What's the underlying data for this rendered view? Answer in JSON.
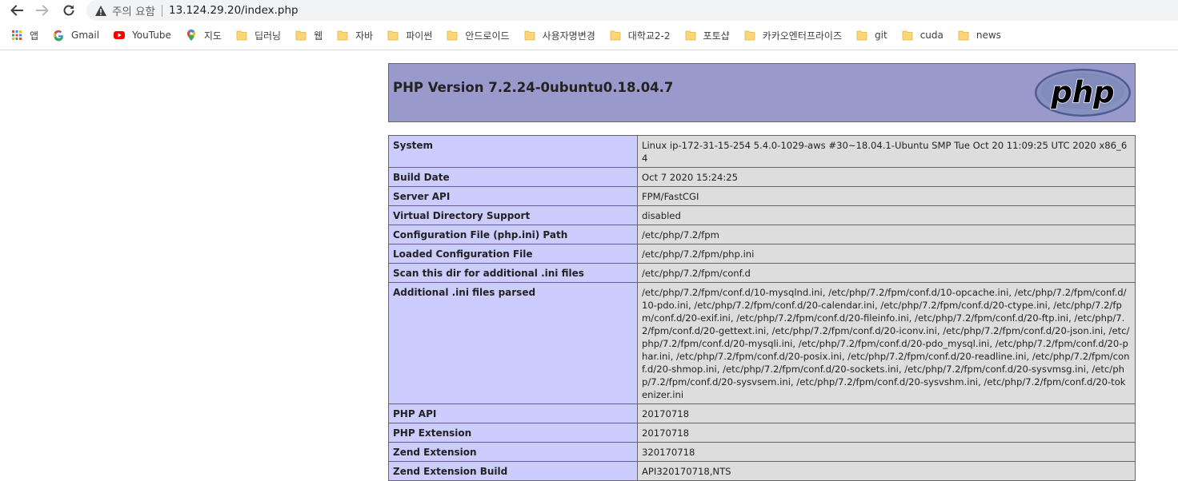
{
  "browser": {
    "status_text": "주의 요함",
    "url": "13.124.29.20/index.php",
    "bookmarks": [
      {
        "label": "앱",
        "icon": "apps-grid-icon"
      },
      {
        "label": "Gmail",
        "icon": "google-icon"
      },
      {
        "label": "YouTube",
        "icon": "youtube-icon"
      },
      {
        "label": "지도",
        "icon": "maps-pin-icon"
      },
      {
        "label": "딥러닝",
        "icon": "folder-icon"
      },
      {
        "label": "웹",
        "icon": "folder-icon"
      },
      {
        "label": "자바",
        "icon": "folder-icon"
      },
      {
        "label": "파이썬",
        "icon": "folder-icon"
      },
      {
        "label": "안드로이드",
        "icon": "folder-icon"
      },
      {
        "label": "사용자명변경",
        "icon": "folder-icon"
      },
      {
        "label": "대학교2-2",
        "icon": "folder-icon"
      },
      {
        "label": "포토샵",
        "icon": "folder-icon"
      },
      {
        "label": "카카오엔터프라이즈",
        "icon": "folder-icon"
      },
      {
        "label": "git",
        "icon": "folder-icon"
      },
      {
        "label": "cuda",
        "icon": "folder-icon"
      },
      {
        "label": "news",
        "icon": "folder-icon"
      }
    ]
  },
  "phpinfo": {
    "title": "PHP Version 7.2.24-0ubuntu0.18.04.7",
    "logo_text": "php",
    "rows": [
      {
        "key": "System",
        "value": "Linux ip-172-31-15-254 5.4.0-1029-aws #30~18.04.1-Ubuntu SMP Tue Oct 20 11:09:25 UTC 2020 x86_64"
      },
      {
        "key": "Build Date",
        "value": "Oct 7 2020 15:24:25"
      },
      {
        "key": "Server API",
        "value": "FPM/FastCGI"
      },
      {
        "key": "Virtual Directory Support",
        "value": "disabled"
      },
      {
        "key": "Configuration File (php.ini) Path",
        "value": "/etc/php/7.2/fpm"
      },
      {
        "key": "Loaded Configuration File",
        "value": "/etc/php/7.2/fpm/php.ini"
      },
      {
        "key": "Scan this dir for additional .ini files",
        "value": "/etc/php/7.2/fpm/conf.d"
      },
      {
        "key": "Additional .ini files parsed",
        "value": "/etc/php/7.2/fpm/conf.d/10-mysqlnd.ini, /etc/php/7.2/fpm/conf.d/10-opcache.ini, /etc/php/7.2/fpm/conf.d/10-pdo.ini, /etc/php/7.2/fpm/conf.d/20-calendar.ini, /etc/php/7.2/fpm/conf.d/20-ctype.ini, /etc/php/7.2/fpm/conf.d/20-exif.ini, /etc/php/7.2/fpm/conf.d/20-fileinfo.ini, /etc/php/7.2/fpm/conf.d/20-ftp.ini, /etc/php/7.2/fpm/conf.d/20-gettext.ini, /etc/php/7.2/fpm/conf.d/20-iconv.ini, /etc/php/7.2/fpm/conf.d/20-json.ini, /etc/php/7.2/fpm/conf.d/20-mysqli.ini, /etc/php/7.2/fpm/conf.d/20-pdo_mysql.ini, /etc/php/7.2/fpm/conf.d/20-phar.ini, /etc/php/7.2/fpm/conf.d/20-posix.ini, /etc/php/7.2/fpm/conf.d/20-readline.ini, /etc/php/7.2/fpm/conf.d/20-shmop.ini, /etc/php/7.2/fpm/conf.d/20-sockets.ini, /etc/php/7.2/fpm/conf.d/20-sysvmsg.ini, /etc/php/7.2/fpm/conf.d/20-sysvsem.ini, /etc/php/7.2/fpm/conf.d/20-sysvshm.ini, /etc/php/7.2/fpm/conf.d/20-tokenizer.ini"
      },
      {
        "key": "PHP API",
        "value": "20170718"
      },
      {
        "key": "PHP Extension",
        "value": "20170718"
      },
      {
        "key": "Zend Extension",
        "value": "320170718"
      },
      {
        "key": "Zend Extension Build",
        "value": "API320170718,NTS"
      }
    ]
  },
  "colors": {
    "header_bg": "#9999cc",
    "key_cell_bg": "#ccccff",
    "value_cell_bg": "#dddddd",
    "border": "#666666"
  }
}
